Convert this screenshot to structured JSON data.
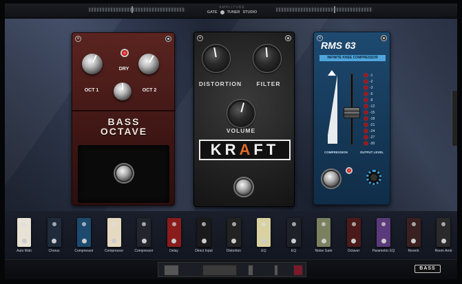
{
  "topbar": {
    "title": "AMPLITUBE",
    "gate_label": "GATE",
    "tuner_label": "TUNER",
    "studio_label": "STUDIO"
  },
  "pedals": {
    "bass_octave": {
      "name_line1": "BASS",
      "name_line2": "OCTAVE",
      "dry_label": "DRY",
      "oct1_label": "OCT 1",
      "oct2_label": "OCT 2"
    },
    "kraft": {
      "distortion_label": "DISTORTION",
      "filter_label": "FILTER",
      "volume_label": "VOLUME",
      "logo_k": "KR",
      "logo_a": "A",
      "logo_rest": "FT"
    },
    "rms63": {
      "title": "RMS 63",
      "subtitle": "INFINITE KNEE COMPRESSOR",
      "compression_label": "COMPRESSION",
      "output_label": "OUTPUT LEVEL",
      "meter_scale": [
        "-1",
        "-2",
        "-3",
        "-6",
        "-9",
        "-12",
        "-15",
        "-18",
        "-21",
        "-24",
        "-27",
        "-30"
      ]
    }
  },
  "browser": {
    "items": [
      {
        "name": "Auto Wah",
        "color": "#e8e2d6"
      },
      {
        "name": "Chorus",
        "color": "#1f2b3a"
      },
      {
        "name": "Compressor",
        "color": "#1d4a6e"
      },
      {
        "name": "Compressor",
        "color": "#e6d9c2"
      },
      {
        "name": "Compressor",
        "color": "#22262c"
      },
      {
        "name": "Delay",
        "color": "#8a1c1c"
      },
      {
        "name": "Direct Input",
        "color": "#1a1a1a"
      },
      {
        "name": "Distortion",
        "color": "#222"
      },
      {
        "name": "EQ",
        "color": "#d9d1a2"
      },
      {
        "name": "EQ",
        "color": "#1e2228"
      },
      {
        "name": "Noise Gate",
        "color": "#7a8060"
      },
      {
        "name": "Octaver",
        "color": "#4a1a1a"
      },
      {
        "name": "Parametric EQ",
        "color": "#5a3a7a"
      },
      {
        "name": "Reverb",
        "color": "#3a2020"
      },
      {
        "name": "Room Amb",
        "color": "#2a2a2a"
      }
    ]
  },
  "bottombar": {
    "bass_label": "BASS"
  }
}
